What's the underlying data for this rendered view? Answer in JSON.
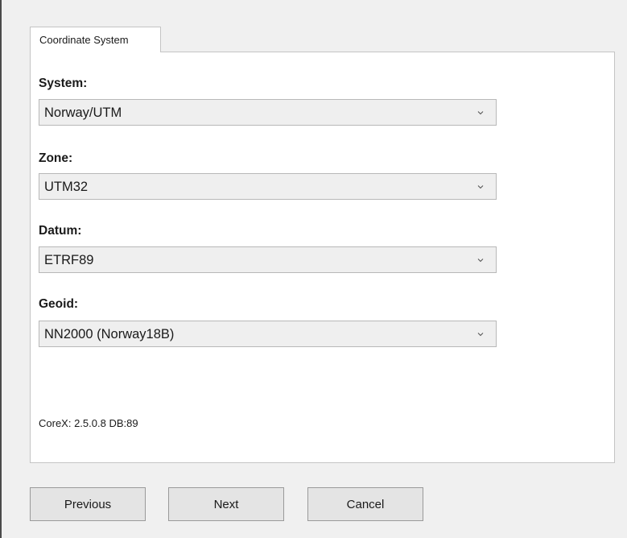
{
  "tab": {
    "label": "Coordinate System"
  },
  "fields": [
    {
      "label": "System:",
      "value": "Norway/UTM"
    },
    {
      "label": "Zone:",
      "value": "UTM32"
    },
    {
      "label": "Datum:",
      "value": "ETRF89"
    },
    {
      "label": "Geoid:",
      "value": "NN2000 (Norway18B)"
    }
  ],
  "version_text": "CoreX: 2.5.0.8 DB:89",
  "buttons": {
    "previous": "Previous",
    "next": "Next",
    "cancel": "Cancel"
  },
  "icons": {
    "dropdown": "chevron-down-icon"
  }
}
